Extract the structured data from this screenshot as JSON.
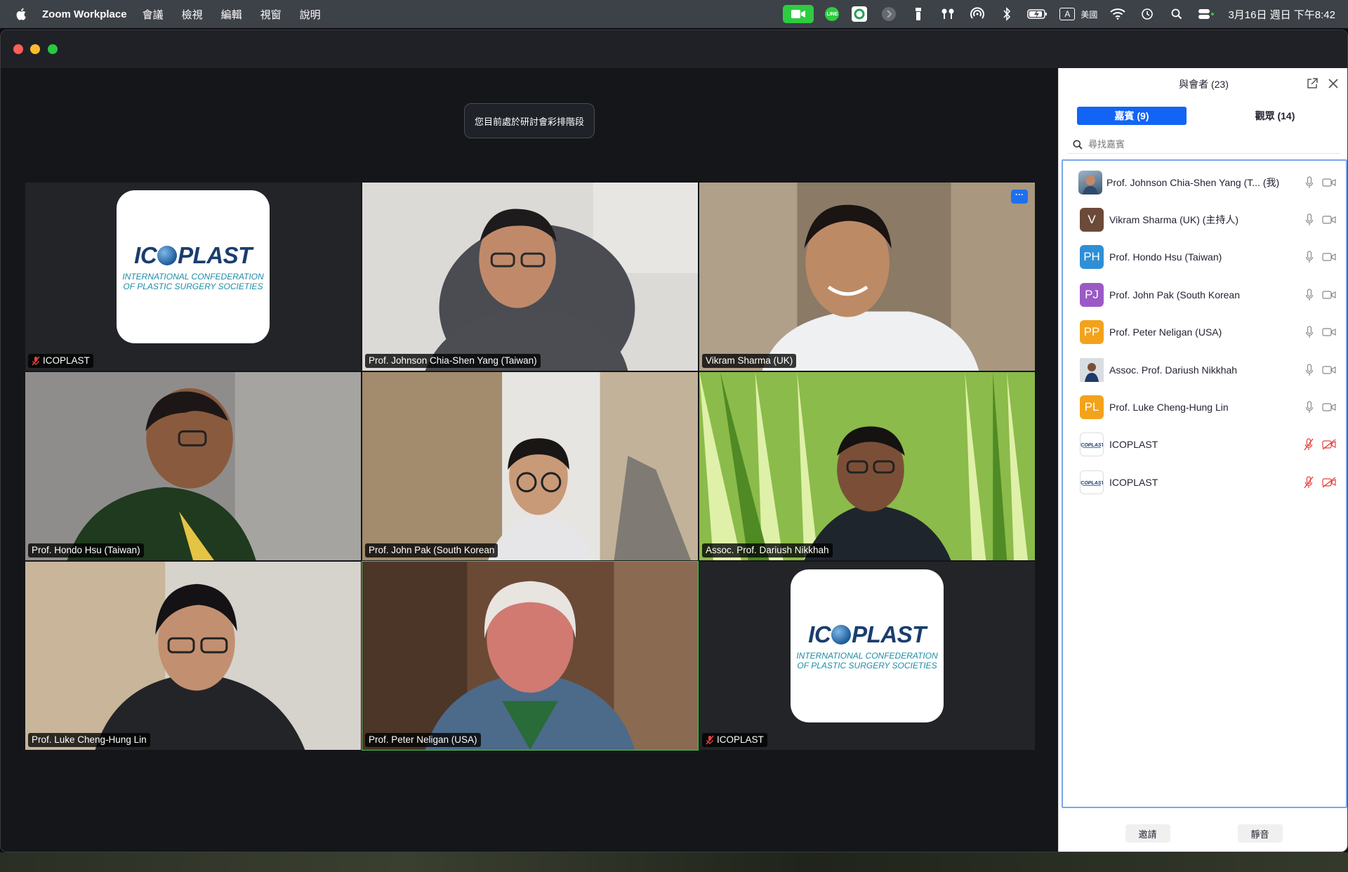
{
  "menubar": {
    "app_name": "Zoom Workplace",
    "menus": [
      "會議",
      "檢視",
      "編輯",
      "視窗",
      "說明"
    ],
    "line_label": "LINE",
    "input_source": "A",
    "input_region": "美國",
    "clock": "3月16日 週日 下午8:42"
  },
  "stage": {
    "rehearsal_banner": "您目前處於研討會彩排階段"
  },
  "logo": {
    "word_left": "IC",
    "word_right": "PLAST",
    "subtitle_line1": "International Confederation",
    "subtitle_line2": "of Plastic Surgery Societies"
  },
  "tiles": [
    {
      "name": "ICOPLAST",
      "kind": "logo",
      "muted": true
    },
    {
      "name": "Prof. Johnson Chia-Shen Yang (Taiwan)",
      "kind": "video"
    },
    {
      "name": "Vikram Sharma (UK)",
      "kind": "video",
      "more_button": "···"
    },
    {
      "name": "Prof. Hondo Hsu (Taiwan)",
      "kind": "video"
    },
    {
      "name": "Prof. John Pak (South Korean",
      "kind": "video"
    },
    {
      "name": "Assoc. Prof. Dariush Nikkhah",
      "kind": "video"
    },
    {
      "name": "Prof. Luke Cheng-Hung Lin",
      "kind": "video"
    },
    {
      "name": "Prof. Peter Neligan (USA)",
      "kind": "video",
      "active_speaker": true
    },
    {
      "name": "ICOPLAST",
      "kind": "logo",
      "muted": true
    }
  ],
  "panel": {
    "title": "與會者 (23)",
    "tab_panelists": "嘉賓 (9)",
    "tab_attendees": "觀眾 (14)",
    "search_placeholder": "尋找嘉賓",
    "participants": [
      {
        "name": "Prof. Johnson Chia-Shen Yang (T...",
        "suffix": "(我)",
        "avatar": "photo",
        "muted": false
      },
      {
        "name": "Vikram Sharma (UK) (主持人)",
        "avatar": "V",
        "avatar_color": "#6b4a3a",
        "muted": false
      },
      {
        "name": "Prof. Hondo Hsu (Taiwan)",
        "avatar": "PH",
        "avatar_color": "#2f8fd6",
        "muted": false
      },
      {
        "name": "Prof. John Pak (South Korean",
        "avatar": "PJ",
        "avatar_color": "#9b59c6",
        "muted": false
      },
      {
        "name": "Prof. Peter Neligan (USA)",
        "avatar": "PP",
        "avatar_color": "#f2a31b",
        "muted": false
      },
      {
        "name": "Assoc. Prof. Dariush Nikkhah",
        "avatar": "photo",
        "muted": false
      },
      {
        "name": "Prof. Luke Cheng-Hung Lin",
        "avatar": "PL",
        "avatar_color": "#f2a31b",
        "muted": false
      },
      {
        "name": "ICOPLAST",
        "avatar": "logo",
        "muted": true
      },
      {
        "name": "ICOPLAST",
        "avatar": "logo",
        "muted": true
      }
    ],
    "invite_button": "邀請",
    "mute_button": "靜音"
  }
}
